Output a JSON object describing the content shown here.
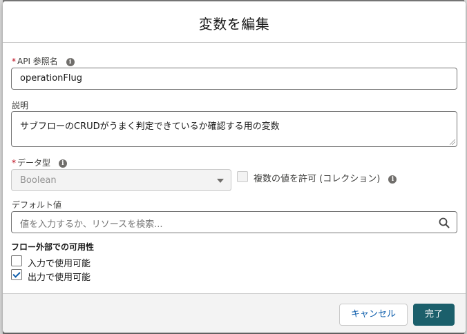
{
  "modal": {
    "title": "変数を編集"
  },
  "fields": {
    "api_name": {
      "required_marker": "*",
      "label": "API 参照名",
      "value": "operationFlug"
    },
    "description": {
      "label": "説明",
      "value": "サブフローのCRUDがうまく判定できているか確認する用の変数"
    },
    "data_type": {
      "required_marker": "*",
      "label": "データ型",
      "value": "Boolean"
    },
    "allow_multiple": {
      "label": "複数の値を許可 (コレクション)",
      "checked": false
    },
    "default_value": {
      "label": "デフォルト値",
      "placeholder": "値を入力するか、リソースを検索..."
    }
  },
  "availability": {
    "heading": "フロー外部での可用性",
    "options": [
      {
        "label": "入力で使用可能",
        "checked": false
      },
      {
        "label": "出力で使用可能",
        "checked": true
      }
    ]
  },
  "footer": {
    "cancel_label": "キャンセル",
    "done_label": "完了"
  },
  "icons": {
    "info": "info-icon",
    "search": "search-icon",
    "dropdown": "chevron-down-icon",
    "check": "check-icon"
  },
  "colors": {
    "brand_button": "#1b5f6b",
    "link_text": "#0b5cab",
    "required": "#ba0517"
  }
}
